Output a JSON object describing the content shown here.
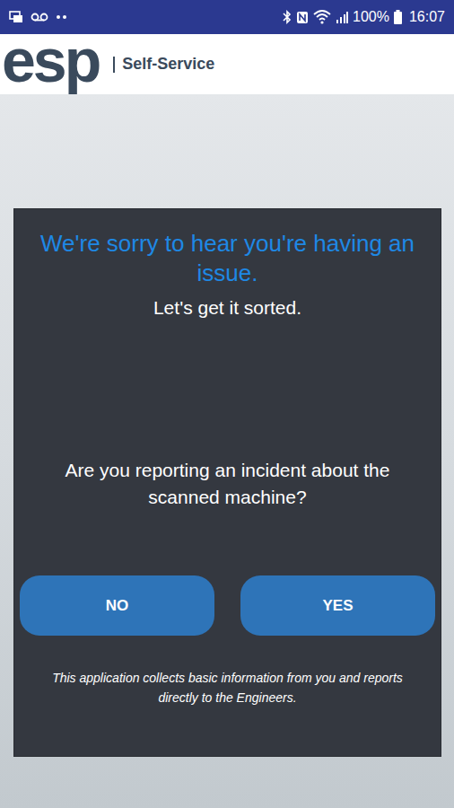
{
  "status_bar": {
    "battery": "100%",
    "time": "16:07"
  },
  "header": {
    "logo": "esp",
    "title": "Self-Service"
  },
  "dialog": {
    "title": "We're sorry to hear you're having an issue.",
    "subtitle": "Let's get it sorted.",
    "question": "Are you reporting an incident about the scanned machine?",
    "buttons": [
      {
        "label": "NO"
      },
      {
        "label": "YES"
      }
    ],
    "footer": "This application collects basic information from you and reports directly to the Engineers."
  }
}
